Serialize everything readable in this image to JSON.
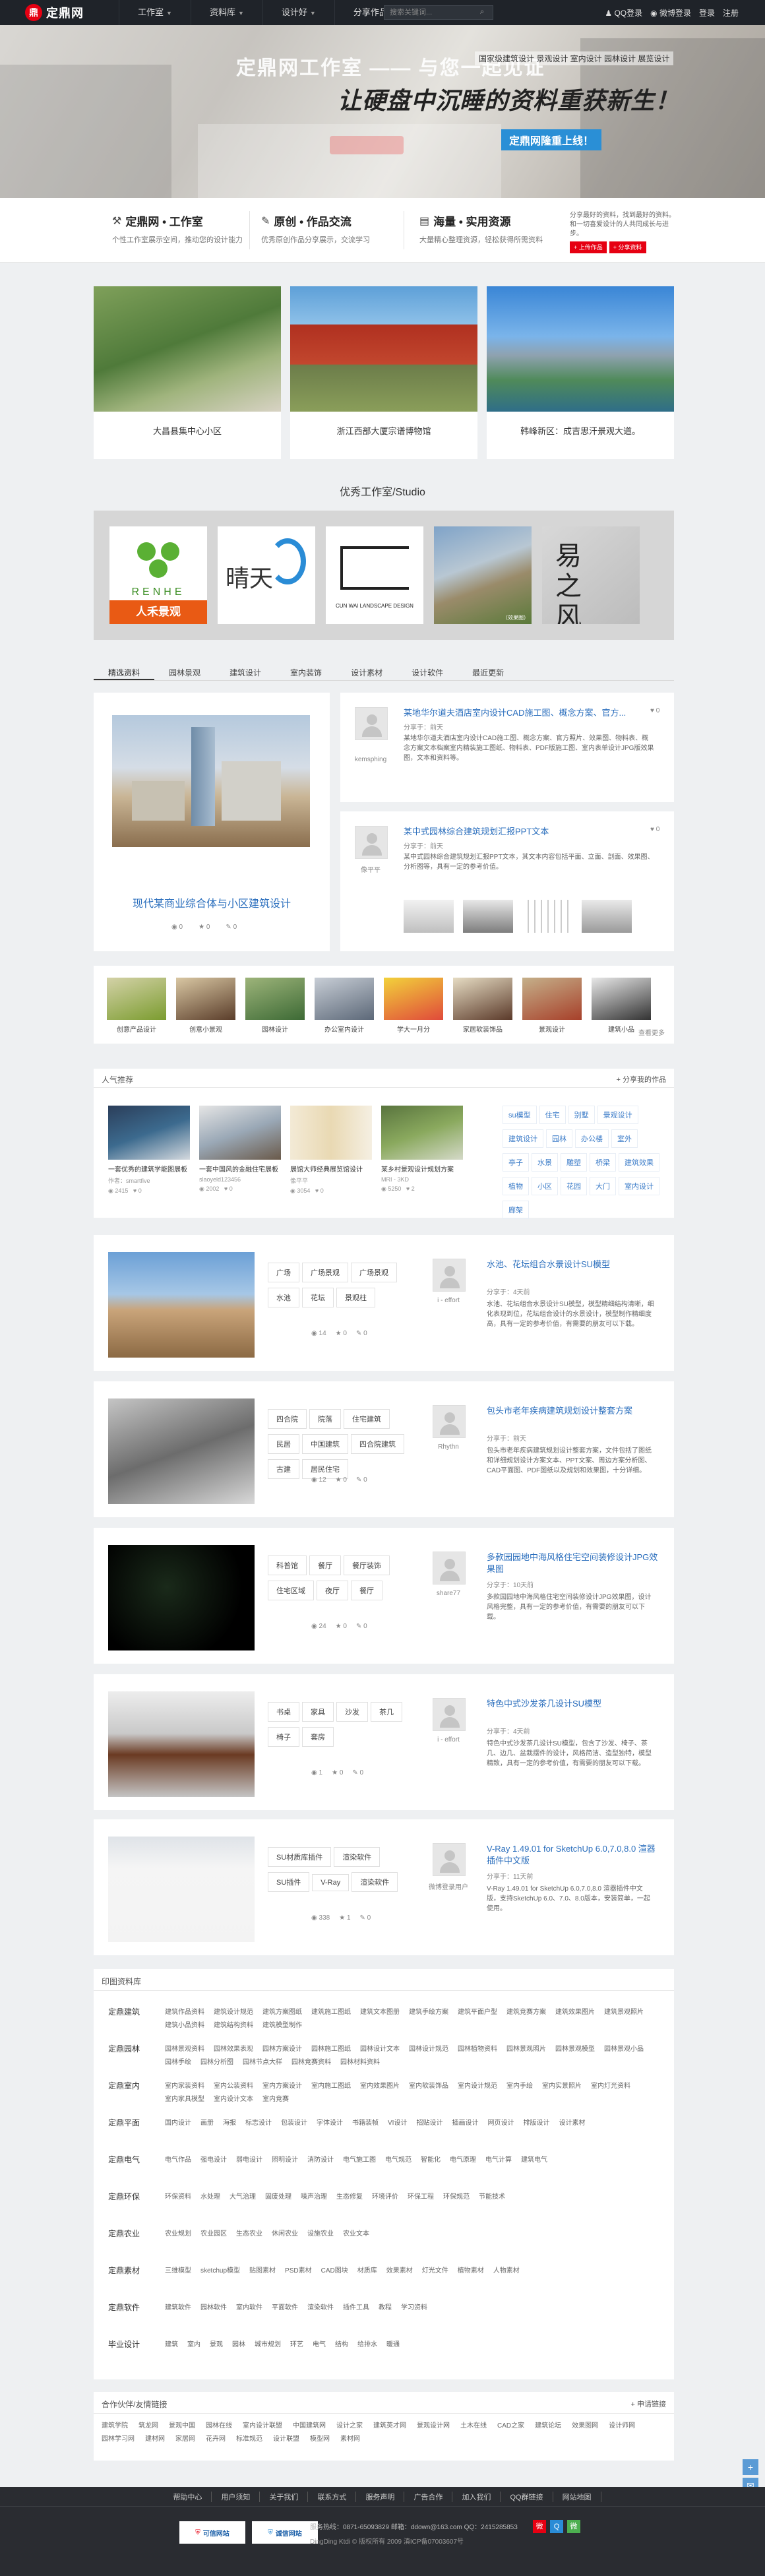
{
  "topbar": {
    "logo": "定鼎网",
    "nav": [
      "工作室",
      "资料库",
      "设计好",
      "分享作品"
    ],
    "search_placeholder": "搜索关键词...",
    "search_btn": "搜索",
    "right": [
      "QQ登录",
      "微博登录",
      "登录",
      "注册"
    ]
  },
  "hero": {
    "line1": "定鼎网工作室 —— 与您一起见证",
    "line2": "让硬盘中沉睡的资料重获新生！",
    "tagline": "国家级建筑设计 景观设计 室内设计 园林设计 展览设计",
    "button": "定鼎网隆重上线！"
  },
  "features": [
    {
      "title": "定鼎网 • 工作室",
      "desc": "个性工作室展示空间，推动您的设计能力"
    },
    {
      "title": "原创 • 作品交流",
      "desc": "优秀原创作品分享展示，交流学习"
    },
    {
      "title": "海量 • 实用资源",
      "desc": "大量精心整理资源，轻松获得所需资料"
    }
  ],
  "feature_right": {
    "text": "分享最好的资料，找到最好的资料。和一切喜爱设计的人共同成长与进步。",
    "btn1": "+ 上传作品",
    "btn2": "+ 分享资料"
  },
  "showcase": [
    {
      "caption": "大昌县集中心小区"
    },
    {
      "caption": "浙江西部大厦宗谱博物馆"
    },
    {
      "caption": "韩峰新区：成吉思汗景观大道。"
    }
  ],
  "studio_title": "优秀工作室/Studio",
  "studio_logos": [
    "人禾景观",
    "晴天",
    "CUN WAI LANDSCAPE DESIGN",
    "（效果图）",
    "易之风"
  ],
  "tabs": [
    "精选资料",
    "园林景观",
    "建筑设计",
    "室内装饰",
    "设计素材",
    "设计软件",
    "最近更新"
  ],
  "featured": {
    "title": "现代某商业综合体与小区建筑设计",
    "stats": [
      "0",
      "0",
      "0"
    ],
    "post1": {
      "title": "某地华尔道夫酒店室内设计CAD施工图、概念方案、官方...",
      "user": "kemsphing",
      "share": "分享于：前天",
      "desc": "某地华尔道夫酒店室内设计CAD施工图、概念方案、官方照片、效果图、物料表、概念方案文本档案室内精装施工图纸、物料表、PDF版施工图、室内表单设计JPG版效果图，文本和资料等。",
      "likes": "0"
    },
    "post2": {
      "title": "某中式园林综合建筑规划汇报PPT文本",
      "user": "像平平",
      "share": "分享于：前天",
      "desc": "某中式园林综合建筑规划汇报PPT文本，其文本内容包括平面、立面、剖面、效果图、分析图等，具有一定的参考价值。",
      "likes": "0"
    }
  },
  "category_icons": [
    "创意产品设计",
    "创意小景观",
    "园林设计",
    "办公室内设计",
    "学大一月分",
    "家居软装饰品",
    "景观设计",
    "建筑小品"
  ],
  "category_more": "查看更多",
  "ranking": {
    "title": "人气推荐",
    "share_label": "+ 分享我的作品",
    "items": [
      {
        "title": "一套优秀的建筑学能图展板",
        "user": "作者：smartfive",
        "views": "2415",
        "likes": "0"
      },
      {
        "title": "一套中国风的金融住宅展板",
        "user": "slaoyeld123456",
        "views": "2002",
        "likes": "0"
      },
      {
        "title": "展馆大师经典展览馆设计",
        "user": "像平平",
        "views": "3054",
        "likes": "0"
      },
      {
        "title": "某乡村景观设计规划方案",
        "user": "MRI - 3KD",
        "views": "5250",
        "likes": "2"
      }
    ],
    "tags": [
      "su模型",
      "住宅",
      "别墅",
      "景观设计",
      "建筑设计",
      "园林",
      "办公楼",
      "室外",
      "亭子",
      "水景",
      "雕塑",
      "桥梁",
      "建筑效果",
      "植物",
      "小区",
      "花园",
      "大门",
      "室内设计",
      "廊架"
    ]
  },
  "rows": [
    {
      "tags": [
        "广场",
        "广场景观",
        "广场景观",
        "水池",
        "花坛",
        "景观柱"
      ],
      "stats": [
        "14",
        "0",
        "0"
      ],
      "user": "i - effort",
      "title": "水池、花坛组合水景设计SU模型",
      "share": "分享于：4天前",
      "desc": "水池、花坛组合水景设计SU模型，模型精细结构清晰，细化表现到位，花坛组合设计的水景设计，模型制作精细度高，具有一定的参考价值，有需要的朋友可以下载。"
    },
    {
      "tags": [
        "四合院",
        "院落",
        "住宅建筑",
        "民居",
        "中国建筑",
        "四合院建筑",
        "古建",
        "居民住宅"
      ],
      "stats": [
        "12",
        "0",
        "0"
      ],
      "user": "Rhythn",
      "title": "包头市老年疾病建筑规划设计整套方案",
      "share": "分享于：前天",
      "desc": "包头市老年疾病建筑规划设计整套方案，文件包括了图纸和详细规划设计方案文本、PPT文案、周边方案分析图、CAD平面图、PDF图纸以及规划和效果图，十分详细。"
    },
    {
      "tags": [
        "科普馆",
        "餐厅",
        "餐厅装饰",
        "住宅区域",
        "夜厅",
        "餐厅"
      ],
      "stats": [
        "24",
        "0",
        "0"
      ],
      "user": "share77",
      "title": "多款园园地中海风格住宅空间装修设计JPG效果图",
      "share": "分享于：10天前",
      "desc": "多款园园地中海风格住宅空间装修设计JPG效果图，设计风格完整，具有一定的参考价值，有需要的朋友可以下载。"
    },
    {
      "tags": [
        "书桌",
        "家具",
        "沙发",
        "茶几",
        "椅子",
        "套房"
      ],
      "stats": [
        "1",
        "0",
        "0"
      ],
      "user": "i - effort",
      "title": "特色中式沙发茶几设计SU模型",
      "share": "分享于：4天前",
      "desc": "特色中式沙发茶几设计SU模型，包含了沙发、椅子、茶几、边几、盆栽摆件的设计，风格简洁、造型独特，模型精致，具有一定的参考价值，有需要的朋友可以下载。"
    },
    {
      "tags": [
        "SU材质库插件",
        "渲染软件",
        "SU插件",
        "V-Ray",
        "渲染软件"
      ],
      "stats": [
        "338",
        "1",
        "0"
      ],
      "user": "微博登录用户",
      "title": "V-Ray 1.49.01 for SketchUp 6.0,7.0,8.0 渲器插件中文版",
      "share": "分享于：11天前",
      "desc": "V-Ray 1.49.01 for SketchUp 6.0,7.0,8.0 渲器插件中文版，支持SketchUp 6.0、7.0、8.0版本，安装简单，一起使用。"
    }
  ],
  "library": {
    "title": "印图资料库",
    "cats": [
      {
        "k": "定鼎建筑",
        "v": [
          "建筑作品资料",
          "建筑设计规范",
          "建筑方案图纸",
          "建筑施工图纸",
          "建筑文本图册",
          "建筑手绘方案",
          "建筑平面户型",
          "建筑竞赛方案",
          "建筑效果图片",
          "建筑景观照片",
          "建筑小品资料",
          "建筑结构资料",
          "建筑模型制作"
        ]
      },
      {
        "k": "定鼎园林",
        "v": [
          "园林景观资料",
          "园林效果表现",
          "园林方案设计",
          "园林施工图纸",
          "园林设计文本",
          "园林设计规范",
          "园林植物资料",
          "园林景观照片",
          "园林景观模型",
          "园林景观小品",
          "园林手绘",
          "园林分析图",
          "园林节点大样",
          "园林竞赛资料",
          "园林材料资料"
        ]
      },
      {
        "k": "定鼎室内",
        "v": [
          "室内家装资料",
          "室内公装资料",
          "室内方案设计",
          "室内施工图纸",
          "室内效果图片",
          "室内软装饰品",
          "室内设计规范",
          "室内手绘",
          "室内实景照片",
          "室内灯光资料",
          "室内家具模型",
          "室内设计文本",
          "室内竞赛"
        ]
      },
      {
        "k": "定鼎平面",
        "v": [
          "国内设计",
          "画册",
          "海报",
          "标志设计",
          "包装设计",
          "字体设计",
          "书籍装帧",
          "VI设计",
          "招贴设计",
          "插画设计",
          "网页设计",
          "排版设计",
          "设计素材"
        ]
      },
      {
        "k": "定鼎电气",
        "v": [
          "电气作品",
          "强电设计",
          "弱电设计",
          "照明设计",
          "消防设计",
          "电气施工图",
          "电气规范",
          "智能化",
          "电气原理",
          "电气计算",
          "建筑电气"
        ]
      },
      {
        "k": "定鼎环保",
        "v": [
          "环保资料",
          "水处理",
          "大气治理",
          "固废处理",
          "噪声治理",
          "生态修复",
          "环境评价",
          "环保工程",
          "环保规范",
          "节能技术"
        ]
      },
      {
        "k": "定鼎农业",
        "v": [
          "农业规划",
          "农业园区",
          "生态农业",
          "休闲农业",
          "设施农业",
          "农业文本"
        ]
      },
      {
        "k": "定鼎素材",
        "v": [
          "三维模型",
          "sketchup模型",
          "贴图素材",
          "PSD素材",
          "CAD图块",
          "材质库",
          "效果素材",
          "灯光文件",
          "植物素材",
          "人物素材"
        ]
      },
      {
        "k": "定鼎软件",
        "v": [
          "建筑软件",
          "园林软件",
          "室内软件",
          "平面软件",
          "渲染软件",
          "插件工具",
          "教程",
          "学习资料"
        ]
      },
      {
        "k": "毕业设计",
        "v": [
          "建筑",
          "室内",
          "景观",
          "园林",
          "城市规划",
          "环艺",
          "电气",
          "结构",
          "给排水",
          "暖通"
        ]
      }
    ]
  },
  "links": {
    "title": "合作伙伴/友情链接",
    "apply": "+ 申请链接",
    "items": [
      "建筑学院",
      "筑龙网",
      "景观中国",
      "园林在线",
      "室内设计联盟",
      "中国建筑网",
      "设计之家",
      "建筑英才网",
      "景观设计网",
      "土木在线",
      "CAD之家",
      "建筑论坛",
      "效果图网",
      "设计师网",
      "园林学习网",
      "建材网",
      "家居网",
      "花卉网",
      "标准规范",
      "设计联盟",
      "模型网",
      "素材网"
    ]
  },
  "footer": {
    "nav": [
      "帮助中心",
      "用户须知",
      "关于我们",
      "联系方式",
      "服务声明",
      "广告合作",
      "加入我们",
      "QQ群链接",
      "网站地图"
    ],
    "contact": "服务热线：0871-65093829  邮箱：ddown@163.com  QQ：2415285853",
    "copyright": "DingDing Ktdi © 版权所有 2009  滇ICP备07003607号",
    "badge1": "可信网站",
    "badge2": "诚信网站"
  },
  "colors": {
    "brand_red": "#e60012",
    "link_blue": "#2a6ebd",
    "topbar": "#1f2329"
  }
}
